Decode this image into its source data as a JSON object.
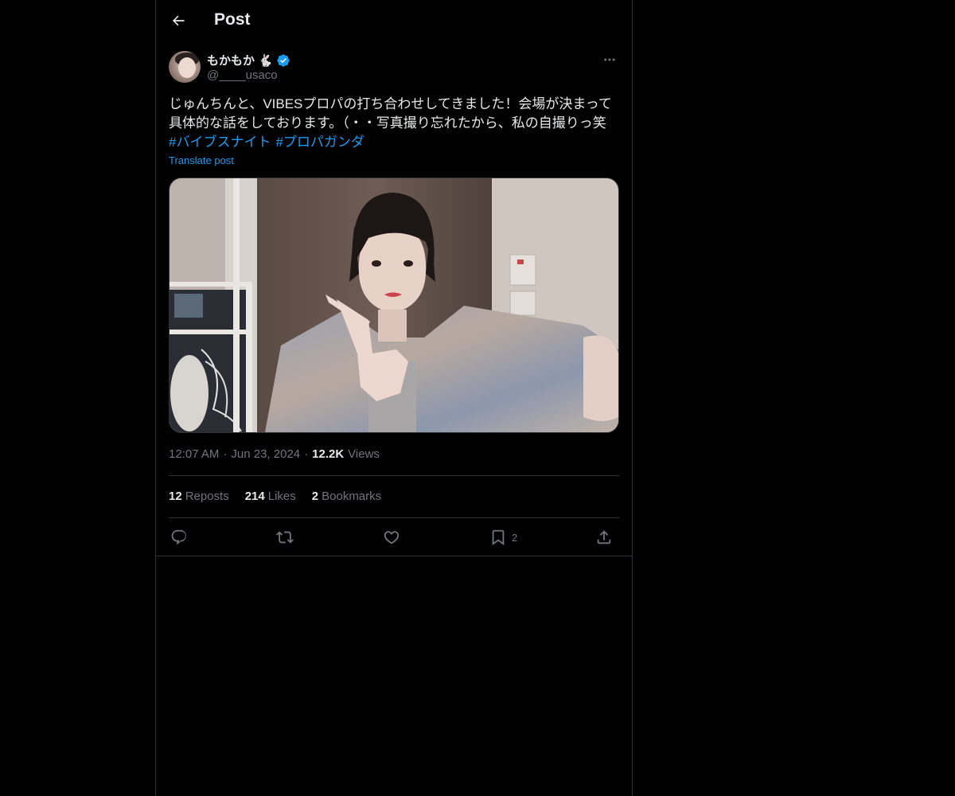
{
  "header": {
    "title": "Post"
  },
  "author": {
    "display_name": "もかもか",
    "emoji": "🐇",
    "handle": "@____usaco",
    "verified": true
  },
  "post": {
    "text": "じゅんちんと、VIBESプロパの打ち合わせしてきました！会場が決まって\n具体的な話をしております。（・・写真撮り忘れたから、私の自撮りっ笑",
    "hashtags": [
      "#バイブスナイト",
      "#プロパガンダ"
    ],
    "translate_label": "Translate post"
  },
  "meta": {
    "time": "12:07 AM",
    "separator": "·",
    "date": "Jun 23, 2024",
    "views_count": "12.2K",
    "views_label": "Views"
  },
  "stats": {
    "reposts_count": "12",
    "reposts_label": "Reposts",
    "likes_count": "214",
    "likes_label": "Likes",
    "bookmarks_count": "2",
    "bookmarks_label": "Bookmarks"
  },
  "actions": {
    "reply_icon": "reply-icon",
    "repost_icon": "repost-icon",
    "like_icon": "heart-icon",
    "bookmark_icon": "bookmark-icon",
    "bookmark_count": "2",
    "share_icon": "share-icon"
  },
  "colors": {
    "background": "#000000",
    "text": "#e7e9ea",
    "muted": "#71767b",
    "accent": "#1d9bf0",
    "border": "#2f3336"
  }
}
